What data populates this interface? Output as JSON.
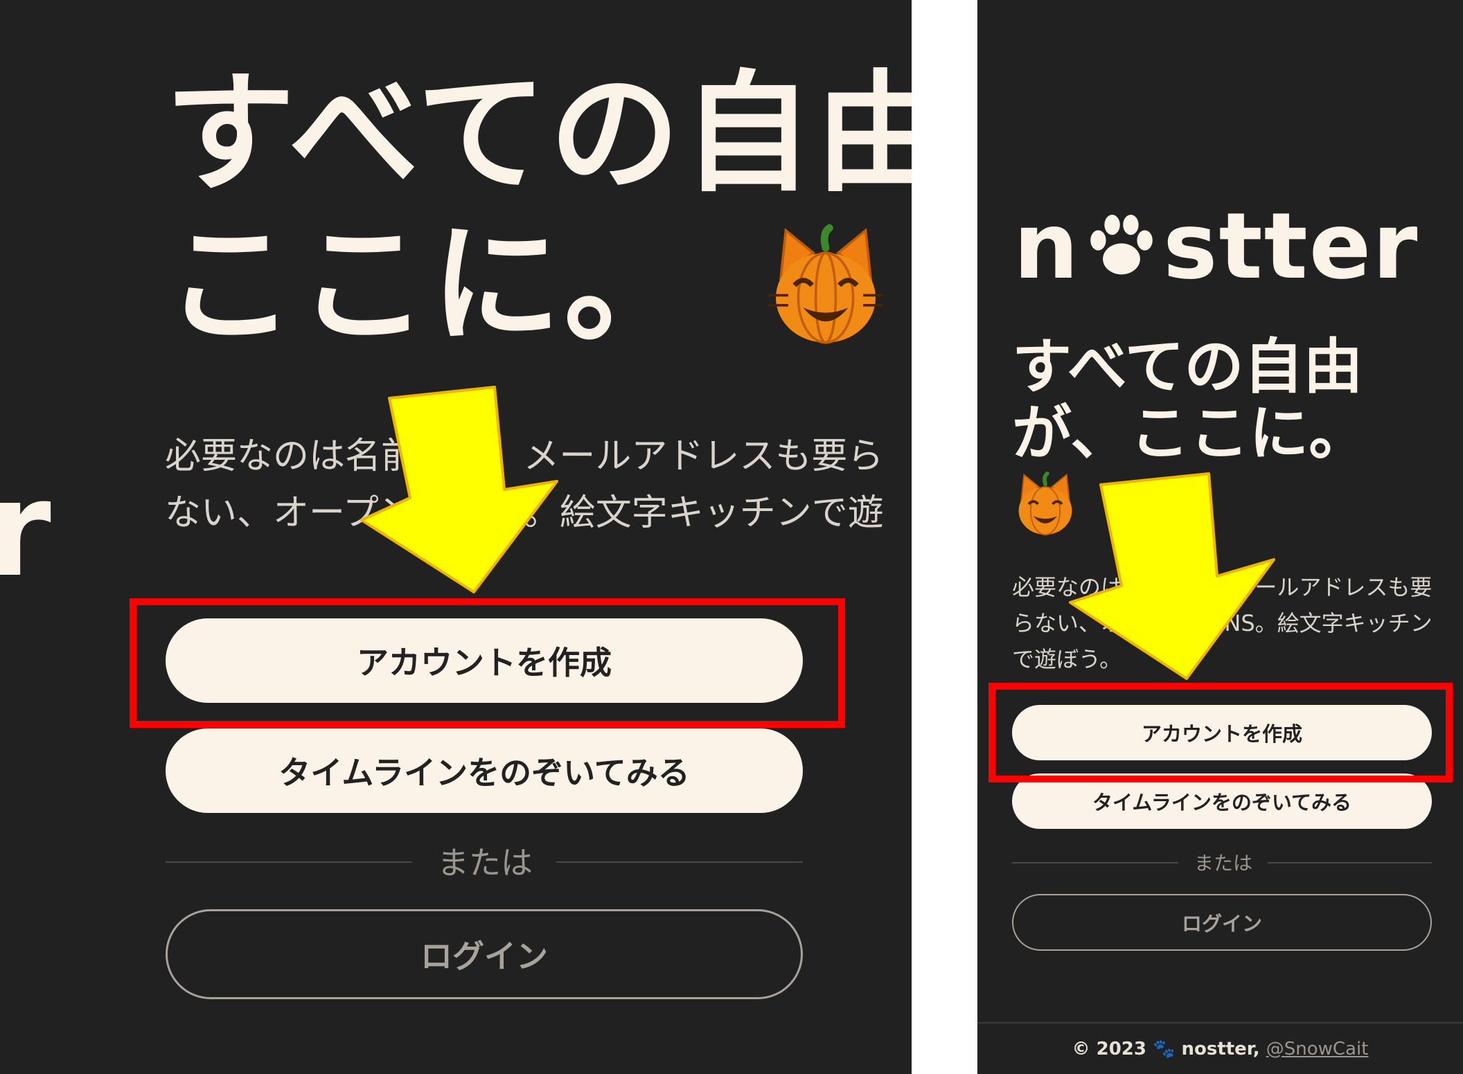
{
  "left": {
    "logo_fragment": "r",
    "headline_line1": "すべての自由",
    "headline_line2": "ここに。",
    "description_line1": "必要なのは名前だけ。メールアドレスも要ら",
    "description_line2": "ない、オープンなSNS。絵文字キッチンで遊",
    "create_account": "アカウントを作成",
    "peek_timeline": "タイムラインをのぞいてみる",
    "or_label": "または",
    "login": "ログイン"
  },
  "right": {
    "logo_n": "n",
    "logo_rest": "stter",
    "headline_line1": "すべての自由",
    "headline_line2": "が、ここに。",
    "description": "必要なのは名前だけ。メールアドレスも要らない、オープンなSNS。絵文字キッチンで遊ぼう。",
    "create_account": "アカウントを作成",
    "peek_timeline": "タイムラインをのぞいてみる",
    "or_label": "または",
    "login": "ログイン",
    "footer_prefix": "© 2023 🐾 nostter, ",
    "footer_link": "@SnowCait"
  },
  "colors": {
    "background": "#222121",
    "cream": "#fbf3e8",
    "annotation_red": "#ff0000",
    "arrow_yellow": "#ffff00"
  },
  "icons": [
    "pumpkin-cat-icon",
    "paw-icon",
    "down-arrow-annotation"
  ]
}
